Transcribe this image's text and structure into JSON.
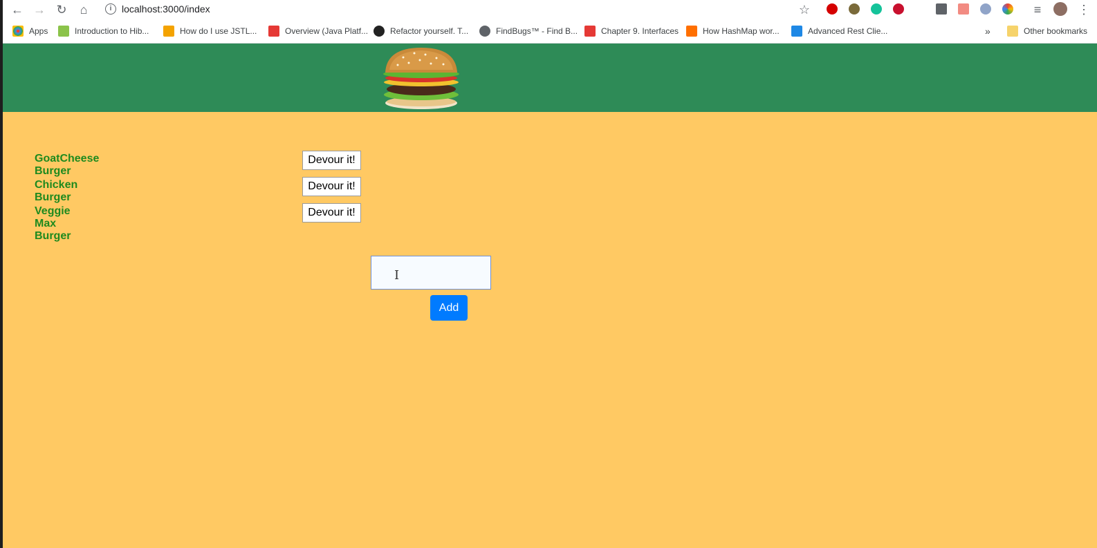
{
  "browser": {
    "url": "localhost:3000/index",
    "bookmarks": [
      {
        "label": "Apps",
        "color": "#4285f4"
      },
      {
        "label": "Introduction to Hib...",
        "color": "#8bc34a"
      },
      {
        "label": "How do I use JSTL...",
        "color": "#f4a300"
      },
      {
        "label": "Overview (Java Platf...",
        "color": "#e53935"
      },
      {
        "label": "Refactor yourself. T...",
        "color": "#222222"
      },
      {
        "label": "FindBugs™ - Find B...",
        "color": "#5f6368"
      },
      {
        "label": "Chapter 9. Interfaces",
        "color": "#e53935"
      },
      {
        "label": "How HashMap wor...",
        "color": "#ff6f00"
      },
      {
        "label": "Advanced Rest Clie...",
        "color": "#1e88e5"
      }
    ],
    "other_bookmarks": "Other bookmarks"
  },
  "app": {
    "burgers": [
      {
        "name": "GoatCheese Burger",
        "button": "Devour it!"
      },
      {
        "name": "Chicken Burger",
        "button": "Devour it!"
      },
      {
        "name": "Veggie Max Burger",
        "button": "Devour it!"
      }
    ],
    "add_label": "Add",
    "input_value": ""
  },
  "colors": {
    "header": "#2e8b57",
    "background": "#ffc963",
    "burger_name": "#1e8a1e",
    "add_button": "#007bff"
  }
}
